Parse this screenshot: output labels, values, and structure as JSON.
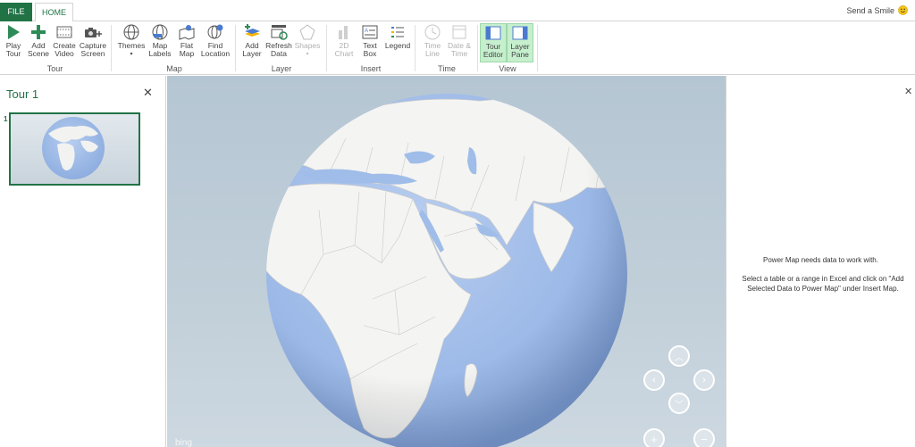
{
  "tabs": {
    "file": "FILE",
    "home": "HOME"
  },
  "header": {
    "send_smile": "Send a Smile"
  },
  "ribbon": {
    "groups": {
      "tour": "Tour",
      "map": "Map",
      "layer": "Layer",
      "insert": "Insert",
      "time": "Time",
      "view": "View"
    },
    "buttons": {
      "play_tour": "Play\nTour",
      "add_scene": "Add\nScene",
      "create_video": "Create\nVideo",
      "capture_screen": "Capture\nScreen",
      "themes": "Themes",
      "map_labels": "Map\nLabels",
      "flat_map": "Flat\nMap",
      "find_location": "Find\nLocation",
      "add_layer": "Add\nLayer",
      "refresh_data": "Refresh\nData",
      "shapes": "Shapes",
      "chart_2d": "2D\nChart",
      "text_box": "Text\nBox",
      "legend": "Legend",
      "time_line": "Time\nLine",
      "date_time": "Date &\nTime",
      "tour_editor": "Tour\nEditor",
      "layer_pane": "Layer\nPane"
    }
  },
  "tour_pane": {
    "title": "Tour 1",
    "scene_number": "1"
  },
  "layer_pane": {
    "message": "Power Map needs data to work with.",
    "instructions": "Select a table or a range in Excel and click on \"Add Selected Data to Power Map\" under Insert Map."
  },
  "map": {
    "attribution": "bing"
  },
  "colors": {
    "accent": "#217346",
    "ocean": "#9fbde8",
    "land": "#f4f4f2",
    "sky": "#b5c6d3"
  }
}
